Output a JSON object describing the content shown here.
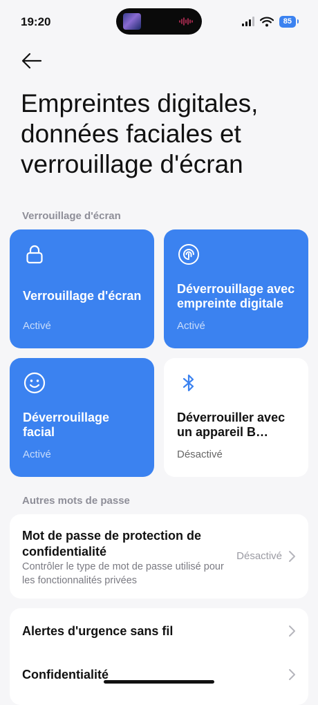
{
  "status": {
    "time": "19:20",
    "battery": "85"
  },
  "page": {
    "title": "Empreintes digitales, données faciales et verrouillage d'écran"
  },
  "sections": {
    "screen_lock": "Verrouillage d'écran",
    "other_passwords": "Autres mots de passe"
  },
  "tiles": [
    {
      "title": "Verrouillage d'écran",
      "status": "Activé",
      "icon": "lock-icon"
    },
    {
      "title": "Déverrouillage avec empreinte digitale",
      "status": "Activé",
      "icon": "fingerprint-icon"
    },
    {
      "title": "Déverrouillage facial",
      "status": "Activé",
      "icon": "face-icon"
    },
    {
      "title": "Déverrouiller avec un appareil B…",
      "status": "Désactivé",
      "icon": "bluetooth-icon"
    }
  ],
  "privacy_password": {
    "title": "Mot de passe de protection de confidentialité",
    "subtitle": "Contrôler le type de mot de passe utilisé pour les fonctionnalités privées",
    "value": "Désactivé"
  },
  "rows": [
    {
      "label": "Alertes d'urgence sans fil"
    },
    {
      "label": "Confidentialité"
    }
  ],
  "colors": {
    "accent": "#3b82f0",
    "background": "#f6f6f8"
  }
}
